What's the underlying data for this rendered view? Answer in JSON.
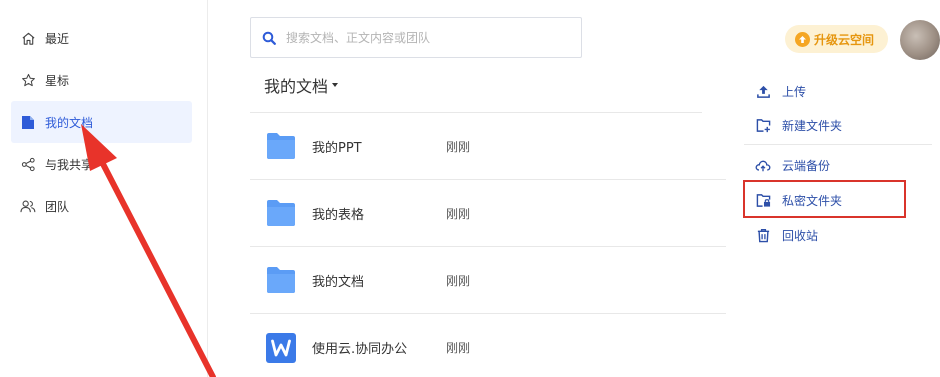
{
  "sidebar": {
    "items": [
      {
        "label": "最近",
        "icon": "home-icon"
      },
      {
        "label": "星标",
        "icon": "star-icon"
      },
      {
        "label": "我的文档",
        "icon": "document-icon",
        "active": true
      },
      {
        "label": "与我共享",
        "icon": "share-icon"
      },
      {
        "label": "团队",
        "icon": "team-icon"
      }
    ]
  },
  "search": {
    "placeholder": "搜索文档、正文内容或团队"
  },
  "main": {
    "heading": "我的文档",
    "files": [
      {
        "name": "我的PPT",
        "time": "刚刚",
        "icon": "folder-icon"
      },
      {
        "name": "我的表格",
        "time": "刚刚",
        "icon": "folder-icon"
      },
      {
        "name": "我的文档",
        "time": "刚刚",
        "icon": "folder-icon"
      },
      {
        "name": "使用云.协同办公",
        "time": "刚刚",
        "icon": "word-doc-icon"
      }
    ]
  },
  "topbar": {
    "upgrade_label": "升级云空间"
  },
  "actions": [
    {
      "label": "上传",
      "icon": "upload-icon"
    },
    {
      "label": "新建文件夹",
      "icon": "new-folder-icon"
    },
    {
      "label": "云端备份",
      "icon": "cloud-backup-icon"
    },
    {
      "label": "私密文件夹",
      "icon": "private-folder-icon"
    },
    {
      "label": "回收站",
      "icon": "trash-icon"
    }
  ],
  "colors": {
    "accent": "#2e5bd8",
    "folder": "#5b9cf5",
    "highlight": "#d9342b",
    "upgrade_bg": "#fdf1d3",
    "upgrade_text": "#e6960f"
  }
}
